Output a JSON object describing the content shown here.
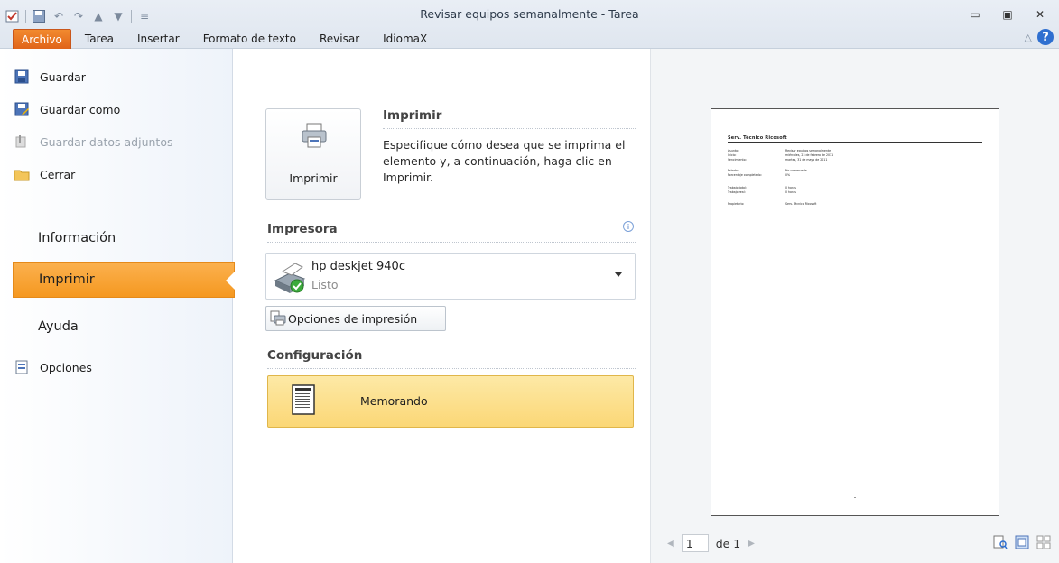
{
  "window": {
    "title": "Revisar equipos semanalmente - Tarea"
  },
  "ribbon": {
    "tabs": [
      "Archivo",
      "Tarea",
      "Insertar",
      "Formato de texto",
      "Revisar",
      "IdiomaX"
    ],
    "help_label": "?"
  },
  "nav": {
    "guardar": "Guardar",
    "guardar_como": "Guardar como",
    "guardar_adjuntos": "Guardar datos adjuntos",
    "cerrar": "Cerrar",
    "informacion": "Información",
    "imprimir": "Imprimir",
    "ayuda": "Ayuda",
    "opciones": "Opciones"
  },
  "print": {
    "button_label": "Imprimir",
    "section_title": "Imprimir",
    "description": "Especifique cómo desea que se imprima el elemento y, a continuación, haga clic en Imprimir."
  },
  "printer": {
    "section_title": "Impresora",
    "info_glyph": "i",
    "name": "hp deskjet 940c",
    "status": "Listo",
    "options_button": "Opciones de impresión"
  },
  "config": {
    "section_title": "Configuración",
    "style": "Memorando"
  },
  "preview": {
    "page_title": "Serv. Técnico Ricosoft",
    "rows": [
      {
        "k": "Asunto:",
        "v": "Revisar equipos semanalmente"
      },
      {
        "k": "Inicio:",
        "v": "miércoles, 23 de febrero de 2011"
      },
      {
        "k": "Vencimiento:",
        "v": "martes, 31 de mayo de 2011"
      },
      {
        "k": "Estado:",
        "v": "No comenzada"
      },
      {
        "k": "Porcentaje completado:",
        "v": "0%"
      },
      {
        "k": "Trabajo total:",
        "v": "0 horas"
      },
      {
        "k": "Trabajo real:",
        "v": "0 horas"
      },
      {
        "k": "Propietario:",
        "v": "Serv. Técnico Ricosoft"
      }
    ],
    "current_page": "1",
    "page_of": "de 1"
  },
  "colors": {
    "archivo_tab": "#e0641a",
    "active_nav": "#f59820",
    "selected_style": "#fbd776"
  }
}
